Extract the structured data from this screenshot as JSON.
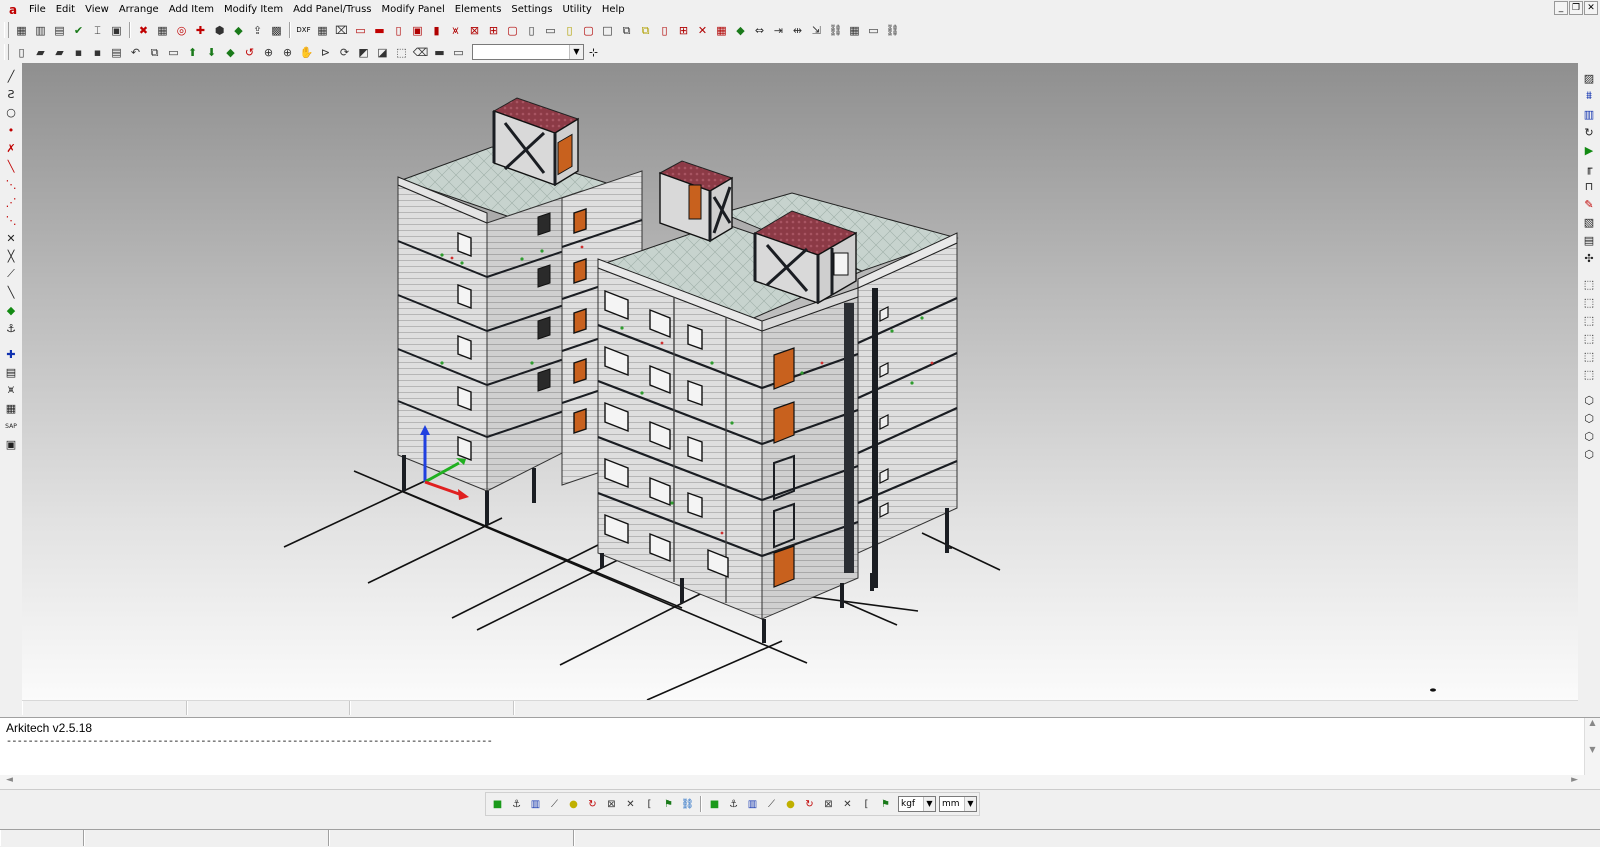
{
  "app": {
    "logo_letter": "a"
  },
  "menu": [
    "File",
    "Edit",
    "View",
    "Arrange",
    "Add Item",
    "Modify Item",
    "Add Panel/Truss",
    "Modify Panel",
    "Elements",
    "Settings",
    "Utility",
    "Help"
  ],
  "window_controls": {
    "minimize": "_",
    "restore": "❐",
    "close": "✕"
  },
  "toolbar1": {
    "icons": [
      "stack-icon",
      "panel-icon",
      "grid-icon",
      "check-icon",
      "pin-icon",
      "layers-icon",
      "delete-icon",
      "table-icon",
      "node-icon",
      "add-node-icon",
      "cube-icon",
      "stack-green-icon",
      "export-icon",
      "lock-icon",
      "dxf-label",
      "table-grid-icon",
      "plan-icon",
      "wall-icon",
      "beam-icon",
      "section-icon",
      "frame-icon",
      "column-icon",
      "truss-icon",
      "brace-icon",
      "joist-icon",
      "opening-icon",
      "door-icon",
      "window-icon",
      "window2-icon",
      "wall2-icon",
      "box-icon",
      "copy-icon",
      "copy2-icon",
      "door2-icon",
      "grid2-icon",
      "cross-icon",
      "table2-icon",
      "cube-green-icon",
      "move-icon",
      "span-icon",
      "split-icon",
      "measure-icon",
      "link-icon",
      "bars-icon",
      "rect-icon",
      "chain-icon"
    ],
    "dxf_label": "DXF"
  },
  "toolbar2": {
    "icons": [
      "new-file-icon",
      "open-file-icon",
      "open-folder-icon",
      "save-icon",
      "save-as-icon",
      "print-icon",
      "undo-icon",
      "copy-icon",
      "paste-icon",
      "arrow-up-green-icon",
      "arrow-down-green-icon",
      "plane-icon",
      "rotate-icon",
      "zoom-window-icon",
      "zoom-extents-icon",
      "pan-icon",
      "mirror-icon",
      "rotate3d-icon",
      "view-icon",
      "view2-icon",
      "fit-icon",
      "eraser-icon",
      "layer-icon",
      "layer2-icon"
    ],
    "combo_value": ""
  },
  "left_tools": [
    {
      "name": "line-tool-icon",
      "glyph": "╱"
    },
    {
      "name": "polyline-tool-icon",
      "glyph": "Ƨ"
    },
    {
      "name": "circle-tool-icon",
      "glyph": "○"
    },
    {
      "name": "point-tool-icon",
      "glyph": "•",
      "cls": "red"
    },
    {
      "name": "trim-tool-icon",
      "glyph": "✗",
      "cls": "red"
    },
    {
      "name": "extend-tool-icon",
      "glyph": "╲",
      "cls": "red"
    },
    {
      "name": "offset-tool-icon",
      "glyph": "⋱",
      "cls": "red"
    },
    {
      "name": "break-tool-icon",
      "glyph": "⋰",
      "cls": "red"
    },
    {
      "name": "chamfer-tool-icon",
      "glyph": "⋱",
      "cls": "red"
    },
    {
      "name": "intersect-tool-icon",
      "glyph": "✕"
    },
    {
      "name": "cross-tool-icon",
      "glyph": "╳"
    },
    {
      "name": "angle-tool-icon",
      "glyph": "⟋"
    },
    {
      "name": "slash-tool-icon",
      "glyph": "╲"
    },
    {
      "name": "fill-tool-icon",
      "glyph": "◆",
      "cls": "green"
    },
    {
      "name": "anchor-tool-icon",
      "glyph": "⚓"
    },
    {
      "name": "gap",
      "glyph": ""
    },
    {
      "name": "axis-tool-icon",
      "glyph": "✚",
      "cls": "blue"
    },
    {
      "name": "report-tool-icon",
      "glyph": "▤"
    },
    {
      "name": "truss-tool-icon",
      "glyph": "⩙"
    },
    {
      "name": "calc-tool-icon",
      "glyph": "▦"
    },
    {
      "name": "sap-tool-icon",
      "glyph": "SAP"
    },
    {
      "name": "device-tool-icon",
      "glyph": "▣"
    }
  ],
  "right_tools": [
    {
      "name": "hatch-icon",
      "glyph": "▨"
    },
    {
      "name": "structure-icon",
      "glyph": "⩩",
      "cls": "blue"
    },
    {
      "name": "panel-view-icon",
      "glyph": "▥",
      "cls": "blue"
    },
    {
      "name": "rotate-view-icon",
      "glyph": "↻"
    },
    {
      "name": "play-icon",
      "glyph": "▶",
      "cls": "green"
    },
    {
      "name": "frame-view-icon",
      "glyph": "╓"
    },
    {
      "name": "bracket-icon",
      "glyph": "⊓"
    },
    {
      "name": "pen-icon",
      "glyph": "✎",
      "cls": "red"
    },
    {
      "name": "sheet-icon",
      "glyph": "▧"
    },
    {
      "name": "sheet2-icon",
      "glyph": "▤"
    },
    {
      "name": "split-view-icon",
      "glyph": "✣"
    },
    {
      "name": "gap",
      "glyph": ""
    },
    {
      "name": "iso-view-1-icon",
      "glyph": "⬚"
    },
    {
      "name": "iso-view-2-icon",
      "glyph": "⬚"
    },
    {
      "name": "iso-view-3-icon",
      "glyph": "⬚"
    },
    {
      "name": "iso-view-4-icon",
      "glyph": "⬚"
    },
    {
      "name": "iso-view-5-icon",
      "glyph": "⬚"
    },
    {
      "name": "iso-view-6-icon",
      "glyph": "⬚"
    },
    {
      "name": "gap",
      "glyph": ""
    },
    {
      "name": "cube-view-1-icon",
      "glyph": "⬡"
    },
    {
      "name": "cube-view-2-icon",
      "glyph": "⬡"
    },
    {
      "name": "cube-view-3-icon",
      "glyph": "⬡"
    },
    {
      "name": "cube-view-4-icon",
      "glyph": "⬡"
    }
  ],
  "console": {
    "title": "Arkitech v2.5.18",
    "line": "------------------------------------------------------------------------------------------"
  },
  "snapbar": {
    "icons": [
      "snap-green-icon",
      "snap-anchor-icon",
      "snap-grid-icon",
      "snap-angle-icon",
      "snap-point-icon",
      "snap-rotate-icon",
      "snap-box-icon",
      "snap-cross-icon",
      "snap-bracket-icon",
      "snap-flag-icon",
      "snap-link-icon",
      "snap-green2-icon",
      "snap-anchor2-icon",
      "snap-grid2-icon",
      "snap-angle2-icon",
      "snap-point2-icon",
      "snap-rotate2-icon",
      "snap-box2-icon",
      "snap-cross2-icon",
      "snap-bracket2-icon",
      "snap-flag2-icon"
    ],
    "force_unit": "kgf",
    "length_unit": "mm"
  },
  "colors": {
    "panel": "#dcdcdc",
    "roof_tile": "#8c3a46",
    "door": "#c8611e",
    "frame": "#1a1d22",
    "axis_x": "#e02020",
    "axis_y": "#20b020",
    "axis_z": "#2040e0"
  }
}
